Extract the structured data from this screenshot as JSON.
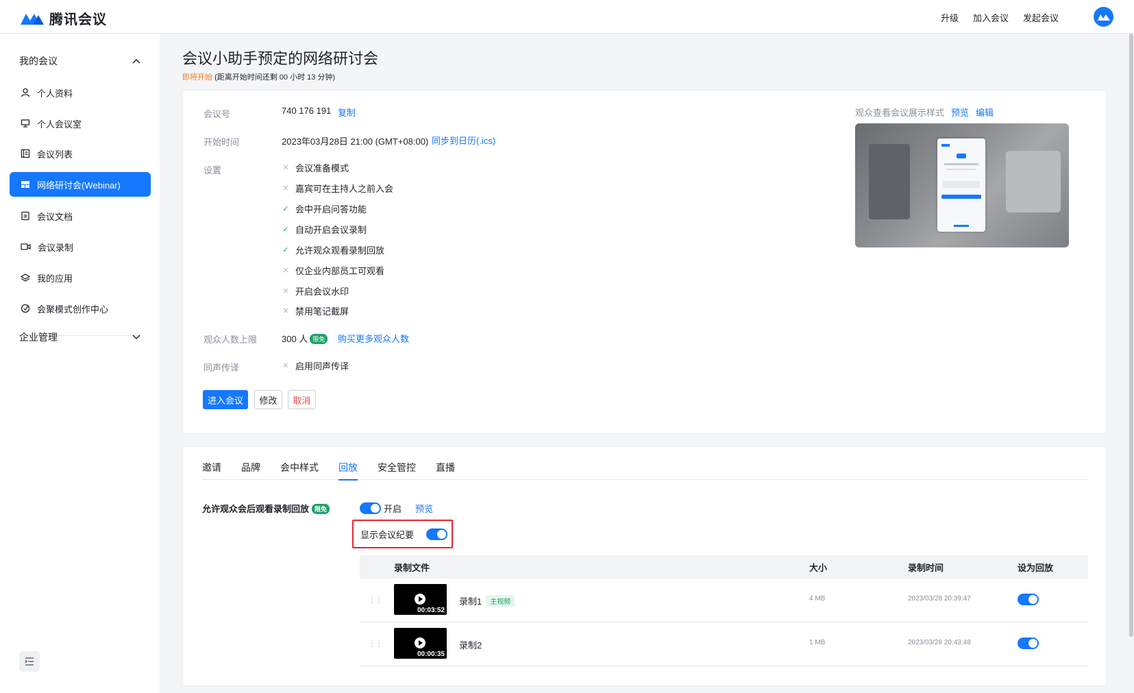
{
  "header": {
    "logo_text": "腾讯会议",
    "nav": [
      "升级",
      "加入会议",
      "发起会议"
    ]
  },
  "sidebar": {
    "my_meetings_label": "我的会议",
    "items": [
      {
        "label": "个人资料",
        "icon": "user-icon"
      },
      {
        "label": "个人会议室",
        "icon": "monitor-icon"
      },
      {
        "label": "会议列表",
        "icon": "list-icon"
      },
      {
        "label": "网络研讨会(Webinar)",
        "icon": "webinar-icon",
        "active": true
      },
      {
        "label": "会议文档",
        "icon": "document-icon"
      },
      {
        "label": "会议录制",
        "icon": "camera-icon"
      },
      {
        "label": "我的应用",
        "icon": "layers-icon"
      },
      {
        "label": "会聚模式创作中心",
        "icon": "creation-icon"
      }
    ],
    "enterprise_label": "企业管理"
  },
  "meeting": {
    "title": "会议小助手预定的网络研讨会",
    "status": "即将开始",
    "countdown": "(距离开始时间还剩 00 小时 13 分钟)",
    "id_label": "会议号",
    "id_value": "740 176 191",
    "copy": "复制",
    "start_label": "开始时间",
    "start_value": "2023年03月28日 21:00 (GMT+08:00)",
    "sync_calendar": "同步到日历(.ics)",
    "settings_label": "设置",
    "settings": [
      {
        "text": "会议准备模式",
        "enabled": false
      },
      {
        "text": "嘉宾可在主持人之前入会",
        "enabled": false
      },
      {
        "text": "会中开启问答功能",
        "enabled": true
      },
      {
        "text": "自动开启会议录制",
        "enabled": true
      },
      {
        "text": "允许观众观看录制回放",
        "enabled": true
      },
      {
        "text": "仅企业内部员工可观看",
        "enabled": false
      },
      {
        "text": "开启会议水印",
        "enabled": false
      },
      {
        "text": "禁用笔记截屏",
        "enabled": false
      }
    ],
    "audience_label": "观众人数上限",
    "audience_value": "300 人",
    "free_badge": "限免",
    "buy_more": "购买更多观众人数",
    "interp_label": "同声传译",
    "interp_value": "启用同声传译",
    "buttons": {
      "enter": "进入会议",
      "modify": "修改",
      "cancel": "取消"
    },
    "preview_label": "观众查看会议展示样式",
    "preview_link": "预览",
    "edit_link": "编辑"
  },
  "tabs": {
    "items": [
      "邀请",
      "品牌",
      "会中样式",
      "回放",
      "安全管控",
      "直播"
    ],
    "active": "回放"
  },
  "playback": {
    "label": "允许观众会后观看录制回放",
    "free_badge": "限免",
    "toggle_label": "开启",
    "preview": "预览",
    "summary_label": "显示会议纪要",
    "columns": [
      "录制文件",
      "大小",
      "录制时间",
      "设为回放"
    ],
    "rows": [
      {
        "name": "录制1",
        "tag": "主视频",
        "duration": "00:03:52",
        "size": "4 MB",
        "time": "2023/03/28 20:39:47"
      },
      {
        "name": "录制2",
        "tag": "",
        "duration": "00:00:35",
        "size": "1 MB",
        "time": "2023/03/28 20:43:48"
      }
    ]
  },
  "colors": {
    "accent": "#1677ff",
    "success": "#22a06b",
    "warning": "#ff7a1a",
    "danger": "#e5262f"
  }
}
